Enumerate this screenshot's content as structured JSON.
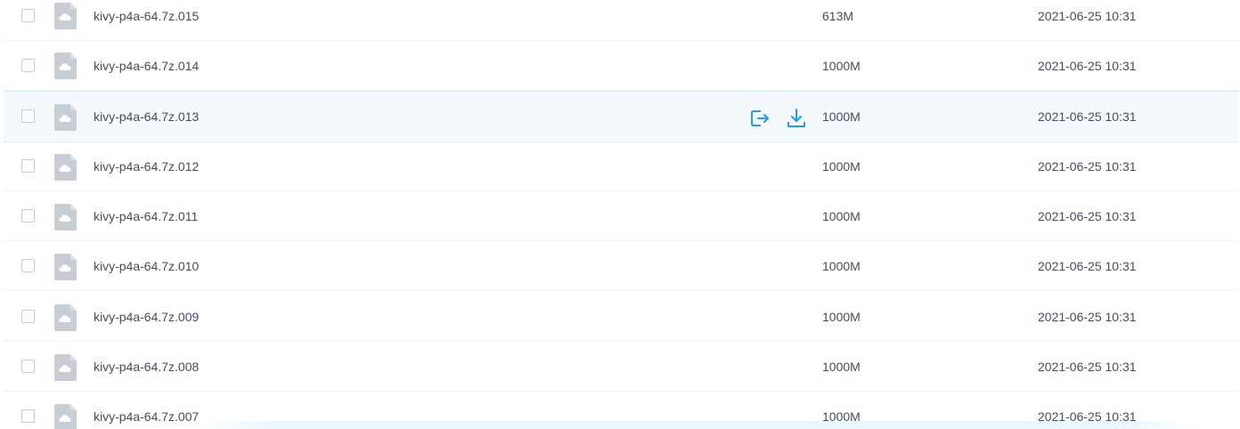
{
  "colors": {
    "text": "#454d5a",
    "hover_row_bg": "#f3f9fc",
    "icon_blue": "#1e9fe6",
    "file_icon_gray": "#c7cdd5"
  },
  "icons": {
    "file": "cloud-file-icon",
    "share": "share-icon",
    "download": "download-icon"
  },
  "files": [
    {
      "name": "kivy-p4a-64.7z.015",
      "size": "613M",
      "modified": "2021-06-25 10:31"
    },
    {
      "name": "kivy-p4a-64.7z.014",
      "size": "1000M",
      "modified": "2021-06-25 10:31"
    },
    {
      "name": "kivy-p4a-64.7z.013",
      "size": "1000M",
      "modified": "2021-06-25 10:31"
    },
    {
      "name": "kivy-p4a-64.7z.012",
      "size": "1000M",
      "modified": "2021-06-25 10:31"
    },
    {
      "name": "kivy-p4a-64.7z.011",
      "size": "1000M",
      "modified": "2021-06-25 10:31"
    },
    {
      "name": "kivy-p4a-64.7z.010",
      "size": "1000M",
      "modified": "2021-06-25 10:31"
    },
    {
      "name": "kivy-p4a-64.7z.009",
      "size": "1000M",
      "modified": "2021-06-25 10:31"
    },
    {
      "name": "kivy-p4a-64.7z.008",
      "size": "1000M",
      "modified": "2021-06-25 10:31"
    },
    {
      "name": "kivy-p4a-64.7z.007",
      "size": "1000M",
      "modified": "2021-06-25 10:31"
    }
  ]
}
